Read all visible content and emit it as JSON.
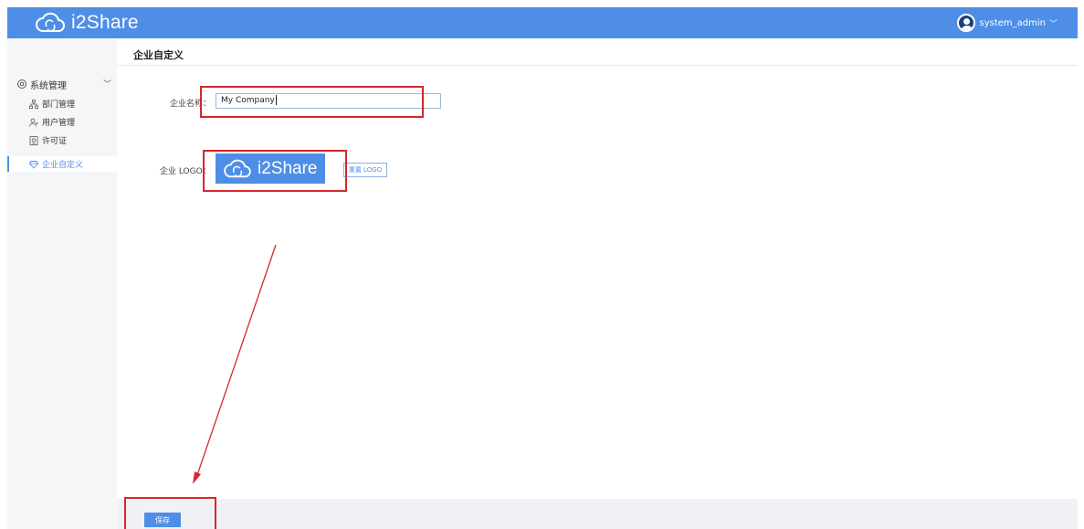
{
  "app": {
    "brand": "i2Share"
  },
  "user": {
    "name": "system_admin"
  },
  "sidebar": {
    "group": "系统管理",
    "items": [
      {
        "label": "部门管理"
      },
      {
        "label": "用户管理"
      },
      {
        "label": "许可证"
      },
      {
        "label": "企业自定义"
      }
    ]
  },
  "main": {
    "title": "企业自定义",
    "name_label": "企业名称：",
    "name_value": "My Company",
    "logo_label": "企业 LOGO：",
    "logo_text": "i2Share",
    "reset_logo": "重置 LOGO",
    "save": "保存"
  },
  "colors": {
    "primary": "#4f8ee6",
    "annotation": "#d6262b"
  }
}
